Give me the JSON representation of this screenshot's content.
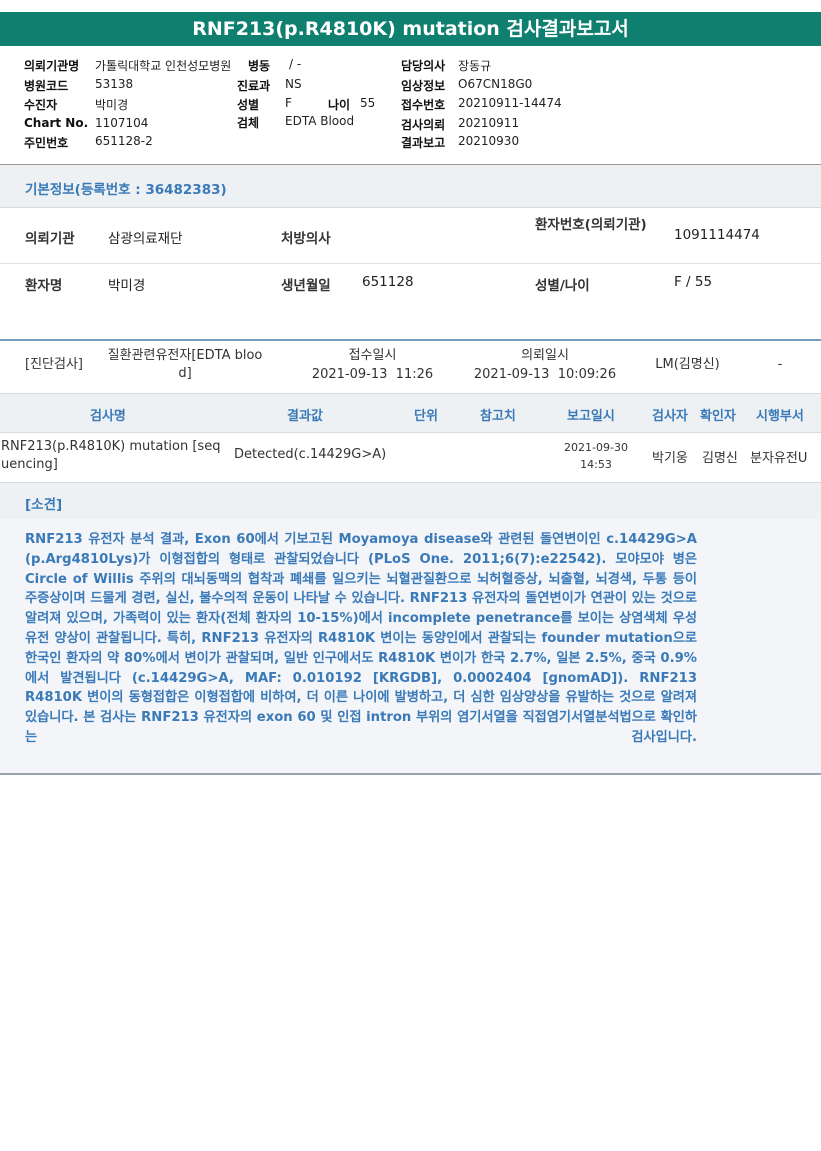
{
  "report": {
    "title": "RNF213(p.R4810K) mutation 검사결과보고서"
  },
  "header": {
    "institution": {
      "label": "의뢰기관명",
      "value": "가톨릭대학교 인천성모병원"
    },
    "ward": {
      "label": "병동",
      "value": "/ -"
    },
    "hospital_code": {
      "label": "병원코드",
      "value": "53138"
    },
    "department": {
      "label": "진료과",
      "value": "NS"
    },
    "recipient": {
      "label": "수진자",
      "value": "박미경"
    },
    "sex": {
      "label": "성별",
      "value": "F"
    },
    "age": {
      "label": "나이",
      "value": "55"
    },
    "chart_no": {
      "label": "Chart No.",
      "value": "1107104"
    },
    "specimen": {
      "label": "검체",
      "value": "EDTA Blood"
    },
    "resident_no": {
      "label": "주민번호",
      "value": "651128-2"
    },
    "doctor": {
      "label": "담당의사",
      "value": "장동규"
    },
    "clinical_info": {
      "label": "임상정보",
      "value": "O67CN18G0"
    },
    "receipt_no": {
      "label": "접수번호",
      "value": "20210911-14474"
    },
    "request_date": {
      "label": "검사의뢰",
      "value": "20210911"
    },
    "result_date": {
      "label": "결과보고",
      "value": "20210930"
    }
  },
  "basic_info": {
    "title": "기본정보(등록번호 : 36482383)",
    "institution_label": "의뢰기관",
    "institution_value": "삼광의료재단",
    "prescriber_label": "처방의사",
    "prescriber_value": "",
    "patient_no_label": "환자번호(의뢰기관)",
    "patient_no_value": "1091114474",
    "patient_name_label": "환자명",
    "patient_name_value": "박미경",
    "birth_label": "생년월일",
    "birth_value": "651128",
    "sex_age_label": "성별/나이",
    "sex_age_value": "F / 55"
  },
  "diagnosis": {
    "category": "[진단검사]",
    "test_group": "질환관련유전자[EDTA blood]",
    "receipt_label": "접수일시",
    "receipt_value": "2021-09-13  11:26",
    "request_label": "의뢰일시",
    "request_value": "2021-09-13  10:09:26",
    "lab": "LM(김명신)",
    "extra": "-"
  },
  "results_table": {
    "headers": [
      "검사명",
      "결과값",
      "단위",
      "참고치",
      "보고일시",
      "검사자",
      "확인자",
      "시행부서"
    ],
    "row": {
      "test_name": "RNF213(p.R4810K) mutation [sequencing]",
      "result": "Detected(c.14429G>A)",
      "unit": "",
      "reference": "",
      "report_date": "2021-09-30",
      "report_time": "14:53",
      "tester": "박기웅",
      "confirmer": "김명신",
      "department": "분자유전U"
    }
  },
  "opinion": {
    "title": "[소견]",
    "body": "RNF213 유전자 분석 결과, Exon 60에서 기보고된 Moyamoya disease와 관련된 돌연변이인 c.14429G>A (p.Arg4810Lys)가 이형접합의 형태로 관찰되었습니다 (PLoS One. 2011;6(7):e22542). 모야모야 병은 Circle of Willis 주위의 대뇌동맥의 협착과 폐쇄를 일으키는 뇌혈관질환으로 뇌허혈증상, 뇌출혈, 뇌경색, 두통 등이 주증상이며 드물게 경련, 실신, 불수의적 운동이 나타날 수 있습니다. RNF213 유전자의 돌연변이가 연관이 있는 것으로 알려져 있으며, 가족력이 있는 환자(전체 환자의 10-15%)에서 incomplete penetrance를 보이는 상염색체 우성 유전 양상이 관찰됩니다. 특히, RNF213 유전자의 R4810K 변이는 동양인에서 관찰되는 founder mutation으로 한국인 환자의 약 80%에서 변이가 관찰되며, 일반 인구에서도 R4810K 변이가 한국 2.7%, 일본 2.5%, 중국 0.9%에서 발견됩니다 (c.14429G>A, MAF: 0.010192 [KRGDB], 0.0002404 [gnomAD]). RNF213 R4810K 변이의 동형접합은 이형접합에 비하여, 더 이른 나이에 발병하고, 더 심한 임상양상을 유발하는 것으로 알려져 있습니다. 본 검사는 RNF213 유전자의 exon 60 및 인접 intron 부위의 염기서열을 직접염기서열분석법으로 확인하는 검사입니다."
  }
}
